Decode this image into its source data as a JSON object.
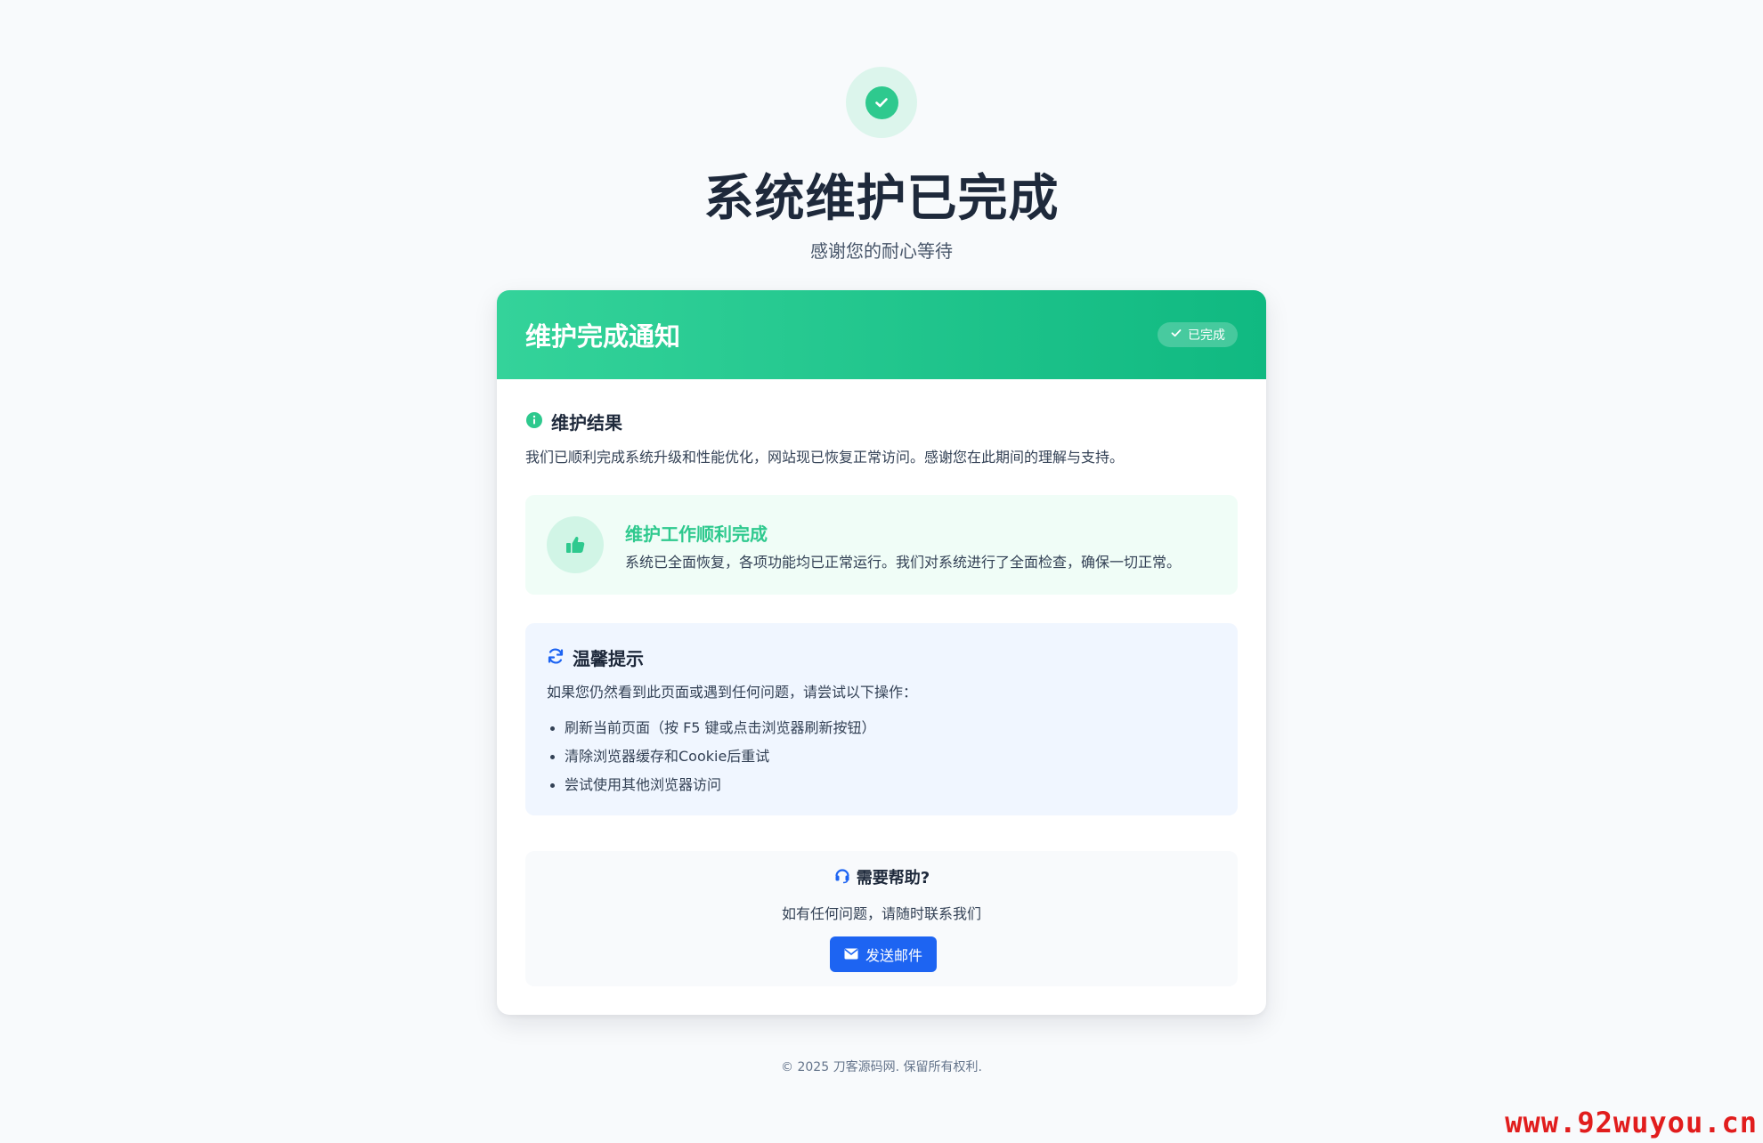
{
  "hero": {
    "icon": "check-circle-icon",
    "title": "系统维护已完成",
    "subtitle": "感谢您的耐心等待"
  },
  "card": {
    "header": {
      "title": "维护完成通知",
      "badge_label": "已完成",
      "badge_icon": "check-icon"
    },
    "result": {
      "icon": "info-circle-icon",
      "title": "维护结果",
      "text": "我们已顺利完成系统升级和性能优化，网站现已恢复正常访问。感谢您在此期间的理解与支持。"
    },
    "success": {
      "icon": "thumbs-up-icon",
      "title": "维护工作顺利完成",
      "text": "系统已全面恢复，各项功能均已正常运行。我们对系统进行了全面检查，确保一切正常。"
    },
    "tips": {
      "icon": "refresh-icon",
      "title": "温馨提示",
      "intro": "如果您仍然看到此页面或遇到任何问题，请尝试以下操作：",
      "items": [
        "刷新当前页面（按 F5 键或点击浏览器刷新按钮）",
        "清除浏览器缓存和Cookie后重试",
        "尝试使用其他浏览器访问"
      ]
    },
    "help": {
      "icon": "headset-icon",
      "title": "需要帮助?",
      "text": "如有任何问题，请随时联系我们",
      "button_label": "发送邮件",
      "button_icon": "envelope-icon"
    }
  },
  "footer": {
    "text": "© 2025 刀客源码网. 保留所有权利."
  },
  "watermark": "www.92wuyou.cn",
  "colors": {
    "accent_green": "#2ec98e",
    "header_gradient_start": "#34d39a",
    "header_gradient_end": "#10b981",
    "primary_blue": "#1d64f2",
    "watermark_red": "#e11d1d"
  }
}
